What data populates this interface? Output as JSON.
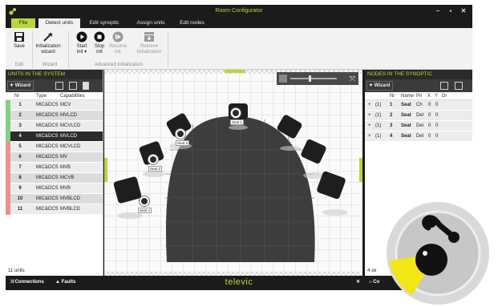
{
  "window": {
    "title": "Room Configurator"
  },
  "tabs": [
    "File",
    "Detect units",
    "Edit synoptic",
    "Assign units",
    "Edit nodes"
  ],
  "ribbon": {
    "save_label": "Save",
    "init_wizard_label_1": "Initialization",
    "init_wizard_label_2": "wizard",
    "start_label_1": "Start",
    "start_label_2": "init ▾",
    "stop_label_1": "Stop",
    "stop_label_2": "init",
    "resume_label_1": "Resume",
    "resume_label_2": "init",
    "retrieve_label_1": "Retrieve",
    "retrieve_label_2": "initialization",
    "group_edit": "Edit",
    "group_wizard": "Wizard",
    "group_advanced": "Advanced Initialization"
  },
  "units_panel": {
    "title": "UNITS IN THE SYSTEM",
    "wizard_label": "Wizard",
    "columns": [
      "Nr",
      "Type",
      "Capabilities"
    ],
    "rows": [
      {
        "nr": "1",
        "type": "MIC&DCS",
        "cap": "MCV",
        "state": "green"
      },
      {
        "nr": "2",
        "type": "MIC&DCS",
        "cap": "MVLCD",
        "state": "green"
      },
      {
        "nr": "3",
        "type": "MIC&DCS",
        "cap": "MCVLCD",
        "state": "green"
      },
      {
        "nr": "4",
        "type": "MIC&DCS",
        "cap": "MVLCD",
        "state": "green"
      },
      {
        "nr": "5",
        "type": "MIC&DCS",
        "cap": "MCVLCD",
        "state": "red"
      },
      {
        "nr": "6",
        "type": "MIC&DCS",
        "cap": "MV",
        "state": "red"
      },
      {
        "nr": "7",
        "type": "MIC&DCS",
        "cap": "MVB",
        "state": "red"
      },
      {
        "nr": "8",
        "type": "MIC&DCS",
        "cap": "MCVB",
        "state": "red"
      },
      {
        "nr": "9",
        "type": "MIC&DCS",
        "cap": "MVB",
        "state": "red"
      },
      {
        "nr": "10",
        "type": "MIC&DCS",
        "cap": "MVBLCD",
        "state": "red"
      },
      {
        "nr": "11",
        "type": "MIC&DCS",
        "cap": "MVBLCD",
        "state": "red"
      }
    ],
    "count": "11 units"
  },
  "synoptic": {
    "seats": [
      "Seat 1",
      "Seat 2",
      "Seat 3",
      "Seat 4"
    ]
  },
  "nodes_panel": {
    "title": "NODES IN THE SYNOPTIC",
    "wizard_label": "Wizard",
    "columns": [
      "Nr",
      "Name",
      "Pri",
      "X",
      "Y",
      "Dr"
    ],
    "rows": [
      {
        "expand": "+",
        "id": "(1)",
        "nr": "1",
        "name": "Seat",
        "prio": "Ch",
        "x": "0",
        "y": "0"
      },
      {
        "expand": "+",
        "id": "(1)",
        "nr": "2",
        "name": "Seat",
        "prio": "Del",
        "x": "0",
        "y": "0"
      },
      {
        "expand": "+",
        "id": "(1)",
        "nr": "3",
        "name": "Seat",
        "prio": "Del",
        "x": "0",
        "y": "0"
      },
      {
        "expand": "+",
        "id": "(1)",
        "nr": "4",
        "name": "Seat",
        "prio": "Del",
        "x": "0",
        "y": "0"
      }
    ],
    "count": "4 se"
  },
  "bottombar": {
    "connections_label": "Connections",
    "faults_label": "Faults",
    "brand": "televic",
    "home_label": "Co"
  },
  "colors": {
    "accent": "#b7d63a",
    "chrome": "#1b1b1b",
    "ok": "#7fd27f",
    "error": "#ef8e8e"
  }
}
